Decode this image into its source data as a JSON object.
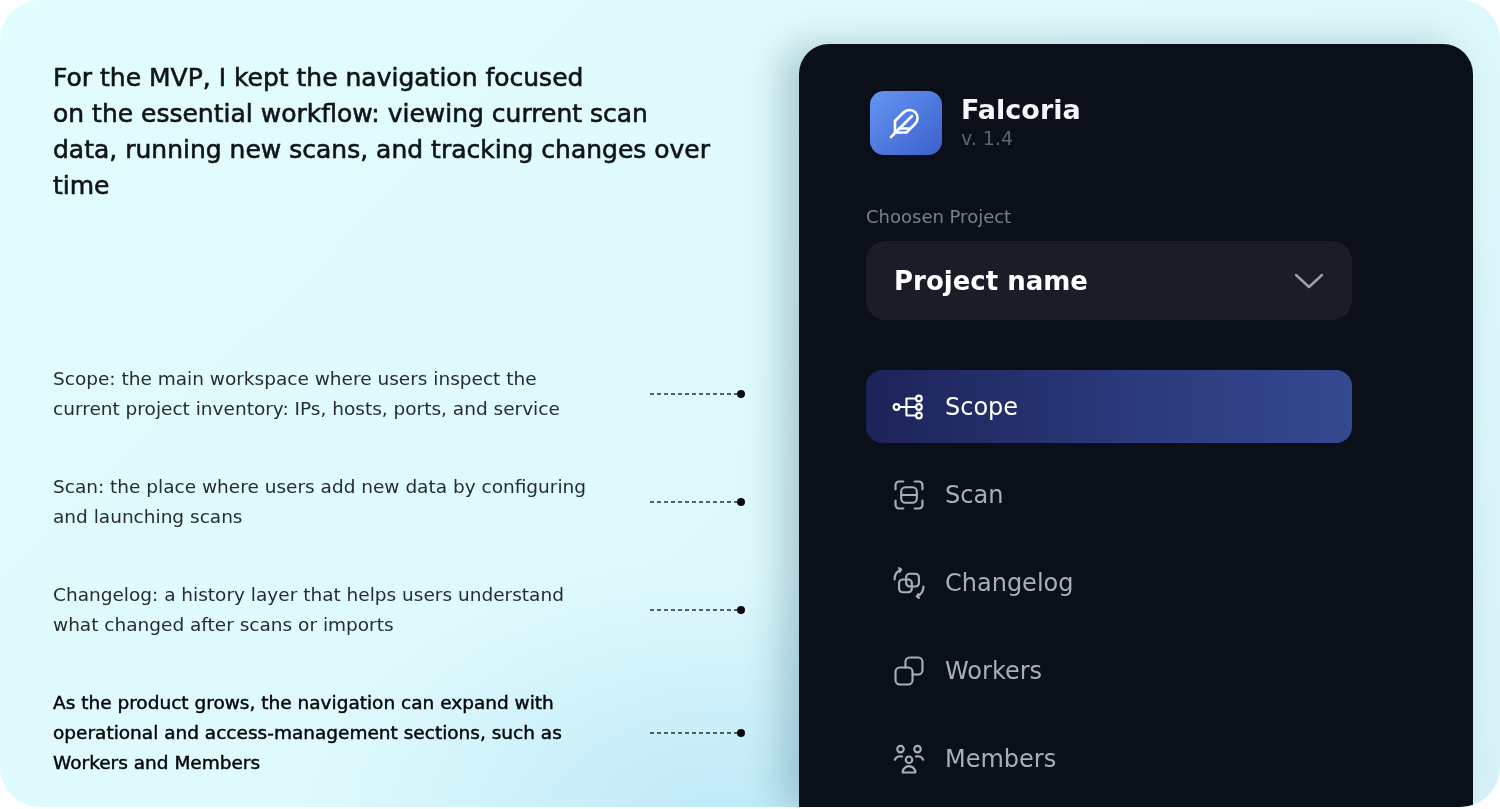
{
  "intro": {
    "heading": "For the MVP, I kept the navigation focused\non the essential workflow: viewing current scan\ndata, running new scans, and tracking changes over\ntime"
  },
  "annotations": [
    {
      "text": "Scope: the main workspace where users inspect the\ncurrent project inventory: IPs, hosts, ports, and service",
      "emphasized": false
    },
    {
      "text": "Scan: the place where users add new data by configuring\nand launching scans",
      "emphasized": false
    },
    {
      "text": "Changelog: a history layer that helps users understand\nwhat changed after scans or imports",
      "emphasized": false
    },
    {
      "text": "As the product grows, the navigation can expand with\noperational and access-management sections, such as\nWorkers and Members",
      "emphasized": true
    }
  ],
  "sidebar": {
    "app": {
      "name": "Falcoria",
      "version": "v. 1.4"
    },
    "project_label": "Choosen Project",
    "project_select": {
      "value": "Project name"
    },
    "nav": [
      {
        "label": "Scope",
        "selected": true
      },
      {
        "label": "Scan",
        "selected": false
      },
      {
        "label": "Changelog",
        "selected": false
      },
      {
        "label": "Workers",
        "selected": false
      },
      {
        "label": "Members",
        "selected": false
      }
    ]
  }
}
